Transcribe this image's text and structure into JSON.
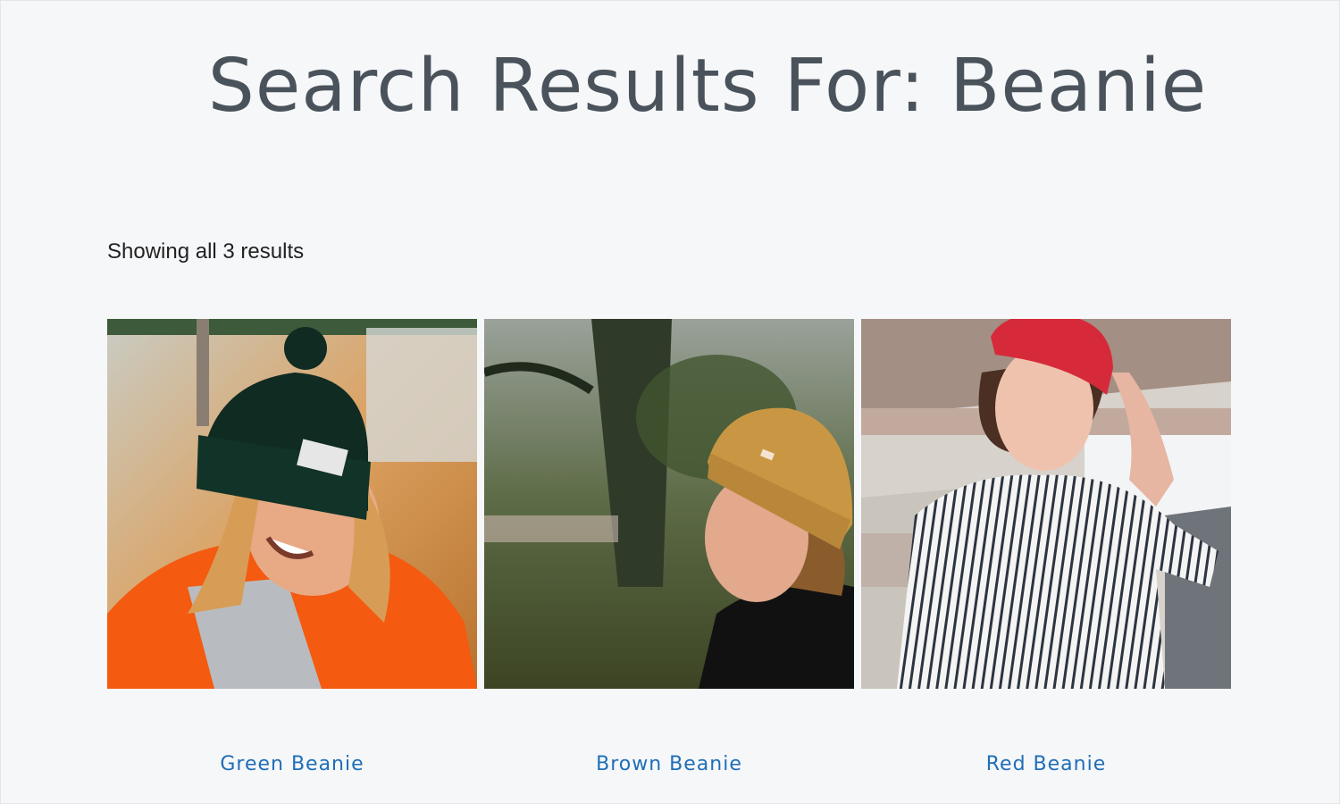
{
  "page": {
    "title": "Search Results For: Beanie",
    "result_count": "Showing all 3 results"
  },
  "products": [
    {
      "title": "Green Beanie",
      "image_icon": "woman-green-beanie-photo",
      "hat_color": "#0f2b22",
      "coat_color": "#f45a10",
      "bg_color": "#d9a55e"
    },
    {
      "title": "Brown Beanie",
      "image_icon": "man-brown-beanie-photo",
      "hat_color": "#c99743",
      "coat_color": "#111111",
      "bg_color": "#4f5a3a"
    },
    {
      "title": "Red Beanie",
      "image_icon": "woman-red-beanie-photo",
      "hat_color": "#d62a3a",
      "coat_color": "#f2f2f2",
      "bg_color": "#b9b4ad"
    }
  ],
  "colors": {
    "background": "#f6f7f9",
    "title": "#4a535b",
    "link": "#1f6eb8"
  }
}
